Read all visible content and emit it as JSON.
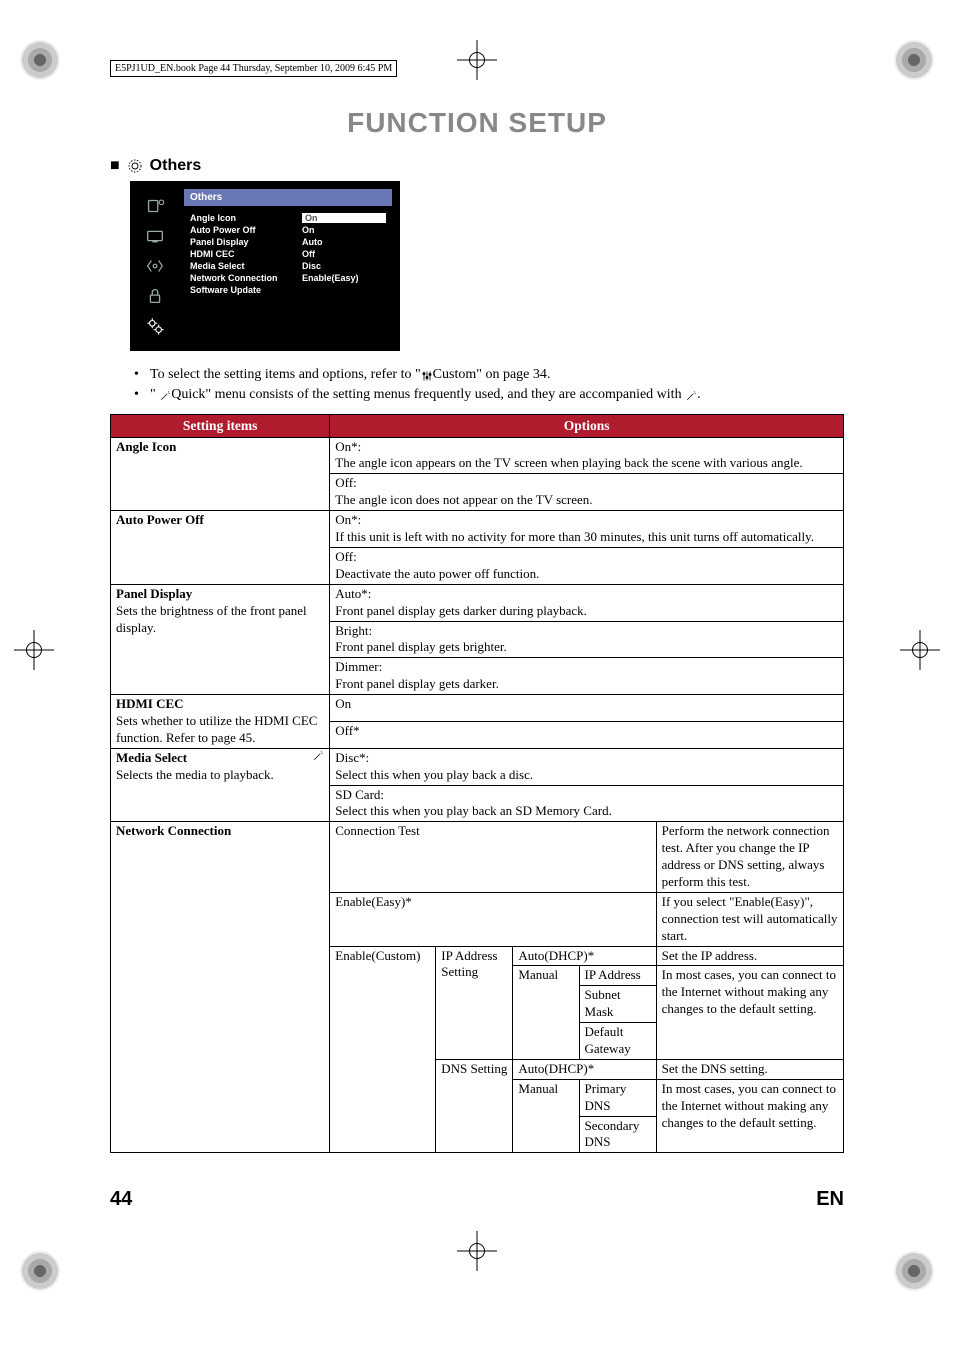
{
  "meta": {
    "top_stamp": "E5PJ1UD_EN.book  Page 44  Thursday, September 10, 2009  6:45 PM"
  },
  "title": "FUNCTION SETUP",
  "section_header": "Others",
  "osd": {
    "banner": "Others",
    "rows": [
      {
        "k": "Angle Icon",
        "v": "On",
        "selected": true
      },
      {
        "k": "Auto Power Off",
        "v": "On"
      },
      {
        "k": "Panel Display",
        "v": "Auto"
      },
      {
        "k": "HDMI CEC",
        "v": "Off"
      },
      {
        "k": "Media Select",
        "v": "Disc"
      },
      {
        "k": "Network Connection",
        "v": "Enable(Easy)"
      },
      {
        "k": "Software Update",
        "v": ""
      }
    ]
  },
  "notes": {
    "line1_pre": "To select the setting items and options, refer to \"",
    "line1_mid": "Custom\" on page 34.",
    "line2_pre": "\" ",
    "line2_mid": "Quick\"  menu consists of the setting menus frequently used, and they are accompanied with ",
    "line2_end": "."
  },
  "table": {
    "header_left": "Setting items",
    "header_right": "Options",
    "rows": [
      {
        "item_title": "Angle Icon",
        "item_sub": "",
        "options": [
          "On*:\nThe angle icon appears on the TV screen when playing back the scene with various angle.",
          "Off:\nThe angle icon does not appear on the TV screen."
        ]
      },
      {
        "item_title": "Auto Power Off",
        "item_sub": "",
        "options": [
          "On*:\nIf this unit is left with no activity for more than 30 minutes, this unit turns off automatically.",
          "Off:\nDeactivate the auto power off function."
        ]
      },
      {
        "item_title": "Panel Display",
        "item_sub": "Sets the brightness of the front panel display.",
        "options": [
          "Auto*:\nFront panel display gets darker during playback.",
          "Bright:\nFront panel display gets brighter.",
          "Dimmer:\nFront panel display gets darker."
        ]
      },
      {
        "item_title": "HDMI CEC",
        "item_sub": "Sets whether to utilize the HDMI CEC function. Refer to page 45.",
        "options": [
          "On",
          "Off*"
        ]
      },
      {
        "item_title": "Media Select",
        "item_sub": "Selects the media to playback.",
        "has_wand": true,
        "options": [
          "Disc*:\nSelect this when you play back a disc.",
          "SD Card:\nSelect this when you play back an SD Memory Card."
        ]
      }
    ],
    "network": {
      "item_title": "Network Connection",
      "connection_test": {
        "label": "Connection Test",
        "desc": "Perform the network connection test. After you change the IP address or DNS setting, always perform this test."
      },
      "enable_easy": {
        "label": "Enable(Easy)*",
        "desc": "If you select \"Enable(Easy)\", connection test will automatically start."
      },
      "enable_custom": {
        "label": "Enable(Custom)",
        "ip": {
          "label": "IP Address Setting",
          "auto": "Auto(DHCP)*",
          "auto_desc": "Set the IP address.",
          "manual": "Manual",
          "manual_items": [
            "IP Address",
            "Subnet Mask",
            "Default Gateway"
          ],
          "manual_desc": "In most cases, you can connect to the Internet without making any changes to the default setting."
        },
        "dns": {
          "label": "DNS Setting",
          "auto": "Auto(DHCP)*",
          "auto_desc": "Set the DNS setting.",
          "manual": "Manual",
          "manual_items": [
            "Primary DNS",
            "Secondary DNS"
          ],
          "manual_desc": "In most cases, you can connect to the Internet without making any changes to the default setting."
        }
      }
    }
  },
  "footer": {
    "page": "44",
    "lang": "EN"
  }
}
